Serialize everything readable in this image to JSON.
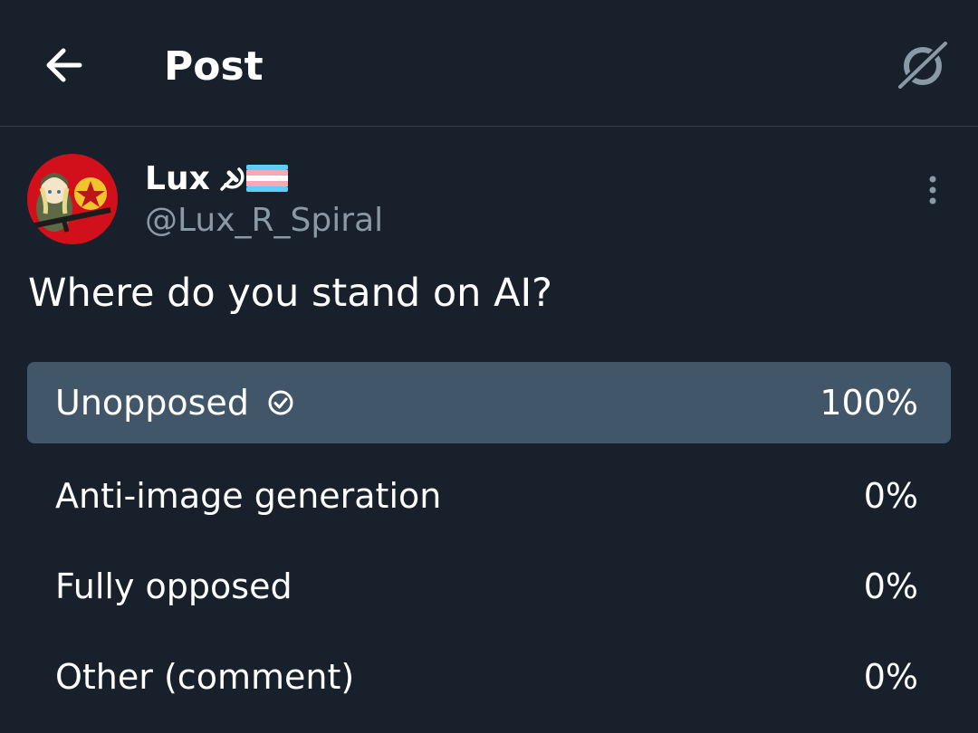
{
  "header": {
    "title": "Post",
    "back_icon": "arrow-left-icon",
    "grok_icon": "grok-icon"
  },
  "post": {
    "author": {
      "display_name": "Lux",
      "name_emojis": [
        "hammer-sickle",
        "transgender-flag"
      ],
      "handle": "@Lux_R_Spiral"
    },
    "text": "Where do you stand on AI?",
    "poll": {
      "options": [
        {
          "label": "Unopposed",
          "percent": "100%",
          "fraction": 1.0,
          "voted": true
        },
        {
          "label": "Anti-image generation",
          "percent": "0%",
          "fraction": 0.0,
          "voted": false
        },
        {
          "label": "Fully opposed",
          "percent": "0%",
          "fraction": 0.0,
          "voted": false
        },
        {
          "label": "Other (comment)",
          "percent": "0%",
          "fraction": 0.0,
          "voted": false
        }
      ]
    }
  },
  "colors": {
    "background": "#17202b",
    "divider": "#38444d",
    "poll_fill": "#425669",
    "secondary_text": "#8b98a5",
    "avatar_red": "#d2101b"
  }
}
